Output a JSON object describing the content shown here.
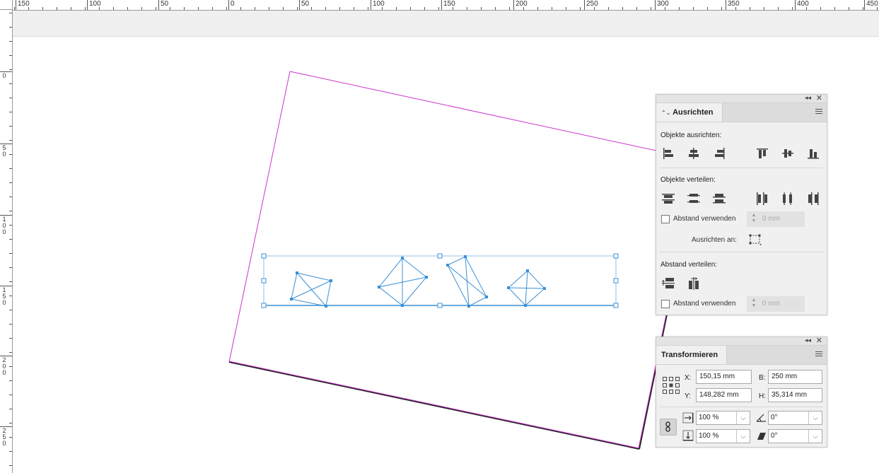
{
  "rulers": {
    "horizontal_labels": [
      "150",
      "100",
      "50",
      "0",
      "50",
      "100",
      "150",
      "200",
      "250",
      "300",
      "350",
      "400",
      "450"
    ],
    "vertical_labels": [
      "0",
      "50",
      "100",
      "150",
      "200",
      "250"
    ]
  },
  "colors": {
    "page_frame": "#cc33cc",
    "selection": "#3a8fd6",
    "shape_stroke": "#3a8fd6"
  },
  "align_panel": {
    "tab_label": "Ausrichten",
    "align_section": "Objekte ausrichten:",
    "distribute_section": "Objekte verteilen:",
    "use_spacing_label": "Abstand verwenden",
    "spacing_value": "0 mm",
    "align_to_label": "Ausrichten an:",
    "spacing_section": "Abstand verteilen:",
    "use_spacing_label_2": "Abstand verwenden",
    "spacing_value_2": "0 mm",
    "icons": [
      "align-left-edges-icon",
      "align-horizontal-centers-icon",
      "align-right-edges-icon",
      "align-top-edges-icon",
      "align-vertical-centers-icon",
      "align-bottom-edges-icon",
      "distribute-top-edges-icon",
      "distribute-vertical-centers-icon",
      "distribute-bottom-edges-icon",
      "distribute-left-edges-icon",
      "distribute-horizontal-centers-icon",
      "distribute-right-edges-icon",
      "align-to-selection-icon",
      "distribute-vertical-space-icon",
      "distribute-horizontal-space-icon"
    ]
  },
  "transform_panel": {
    "tab_label": "Transformieren",
    "x_label": "X:",
    "x_value": "150,15 mm",
    "y_label": "Y:",
    "y_value": "148,282 mm",
    "w_label": "B:",
    "w_value": "250 mm",
    "h_label": "H:",
    "h_value": "35,314 mm",
    "scale_x": "100 %",
    "scale_y": "100 %",
    "rotation": "0°",
    "shear": "0°",
    "icons": [
      "reference-point-icon",
      "constrain-proportions-icon",
      "scale-x-icon",
      "scale-y-icon",
      "rotation-angle-icon",
      "shear-angle-icon"
    ]
  }
}
